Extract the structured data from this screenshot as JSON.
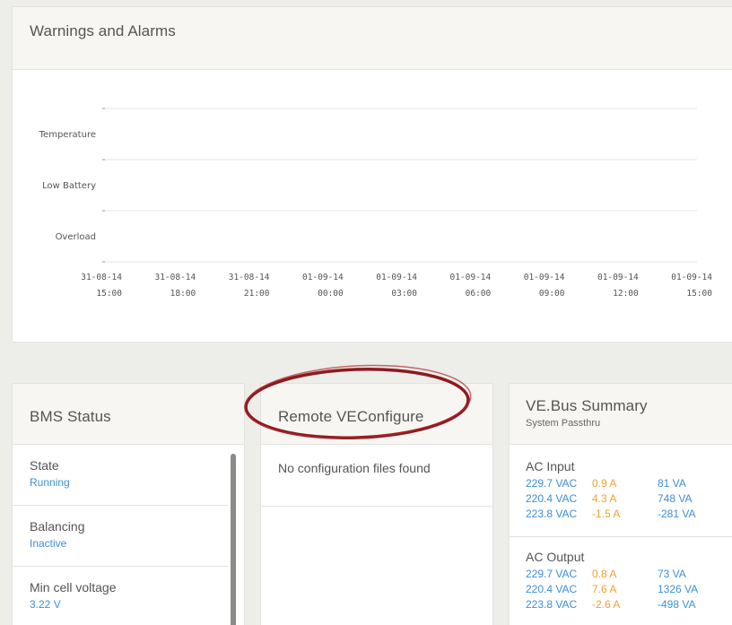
{
  "warnings": {
    "title": "Warnings and Alarms",
    "rows": [
      "Temperature",
      "Low Battery",
      "Overload"
    ],
    "x_ticks": [
      {
        "date": "31-08-14",
        "time": "15:00"
      },
      {
        "date": "31-08-14",
        "time": "18:00"
      },
      {
        "date": "31-08-14",
        "time": "21:00"
      },
      {
        "date": "01-09-14",
        "time": "00:00"
      },
      {
        "date": "01-09-14",
        "time": "03:00"
      },
      {
        "date": "01-09-14",
        "time": "06:00"
      },
      {
        "date": "01-09-14",
        "time": "09:00"
      },
      {
        "date": "01-09-14",
        "time": "12:00"
      },
      {
        "date": "01-09-14",
        "time": "15:00"
      }
    ]
  },
  "bms": {
    "title": "BMS Status",
    "rows": [
      {
        "label": "State",
        "value": "Running"
      },
      {
        "label": "Balancing",
        "value": "Inactive"
      },
      {
        "label": "Min cell voltage",
        "value": "3.22 V"
      }
    ]
  },
  "remote": {
    "title": "Remote VEConfigure",
    "message": "No configuration files found"
  },
  "vebus": {
    "title": "VE.Bus Summary",
    "subtitle": "System Passthru",
    "ac_input": {
      "label": "AC Input",
      "lines": [
        {
          "voltage": "229.7 VAC",
          "current": "0.9 A",
          "power": "81 VA"
        },
        {
          "voltage": "220.4 VAC",
          "current": "4.3 A",
          "power": "748 VA"
        },
        {
          "voltage": "223.8 VAC",
          "current": "-1.5 A",
          "power": "-281 VA"
        }
      ]
    },
    "ac_output": {
      "label": "AC Output",
      "lines": [
        {
          "voltage": "229.7 VAC",
          "current": "0.8 A",
          "power": "73 VA"
        },
        {
          "voltage": "220.4 VAC",
          "current": "7.6 A",
          "power": "1326 VA"
        },
        {
          "voltage": "223.8 VAC",
          "current": "-2.6 A",
          "power": "-498 VA"
        }
      ]
    }
  },
  "colors": {
    "value_blue": "#3d8fd8",
    "current_orange": "#f0a030",
    "highlight_circle": "#a31d22"
  }
}
